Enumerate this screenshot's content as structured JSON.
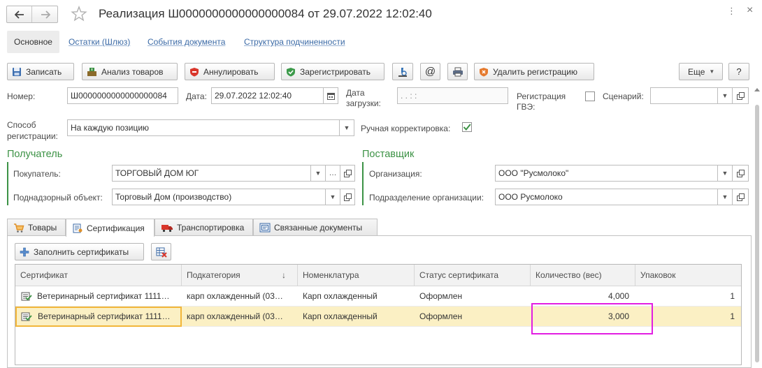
{
  "window": {
    "title": "Реализация Ш0000000000000000084 от 29.07.2022 12:02:40",
    "more_glyph": "⋮",
    "close_glyph": "×"
  },
  "page_tabs": [
    "Основное",
    "Остатки (Шлюз)",
    "События документа",
    "Структура подчиненности"
  ],
  "toolbar": {
    "save": "Записать",
    "analyze": "Анализ товаров",
    "cancel": "Аннулировать",
    "register": "Зарегистрировать",
    "at_symbol": "@",
    "delete_reg": "Удалить регистрацию",
    "more": "Еще",
    "help": "?"
  },
  "form": {
    "number_label": "Номер:",
    "number_value": "Ш0000000000000000084",
    "date_label": "Дата:",
    "date_value": "29.07.2022 12:02:40",
    "load_date_label_1": "Дата",
    "load_date_label_2": "загрузки:",
    "load_date_value": " .  .      :  :",
    "gve_label_1": "Регистрация",
    "gve_label_2": "ГВЭ:",
    "scenario_label": "Сценарий:",
    "scenario_value": "",
    "method_label_1": "Способ",
    "method_label_2": "регистрации:",
    "method_value": "На каждую позицию",
    "manual_label": "Ручная корректировка:"
  },
  "receiver": {
    "title": "Получатель",
    "buyer_label": "Покупатель:",
    "buyer_value": "ТОРГОВЫЙ ДОМ ЮГ",
    "object_label": "Поднадзорный объект:",
    "object_value": "Торговый Дом (производство)"
  },
  "supplier": {
    "title": "Поставщик",
    "org_label": "Организация:",
    "org_value": "ООО \"Русмолоко\"",
    "dept_label": "Подразделение организации:",
    "dept_value": "ООО Русмолоко"
  },
  "tabs": [
    "Товары",
    "Сертификация",
    "Транспортировка",
    "Связанные документы"
  ],
  "cert_panel": {
    "fill_button": "Заполнить сертификаты"
  },
  "table": {
    "columns": [
      "Сертификат",
      "Подкатегория",
      "Номенклатура",
      "Статус сертификата",
      "Количество (вес)",
      "Упаковок"
    ],
    "sort_glyph": "↓",
    "rows": [
      [
        "Ветеринарный сертификат 1111…",
        "карп охлажденный (03…",
        "Карп охлажденный",
        "Оформлен",
        "4,000",
        "1"
      ],
      [
        "Ветеринарный сертификат 1111…",
        "карп охлажденный (03…",
        "Карп охлажденный",
        "Оформлен",
        "3,000",
        "1"
      ]
    ]
  },
  "colors": {
    "group_title": "#3c9245",
    "link": "#3b6aa6",
    "selected_row": "#fbf0c4",
    "highlight_box": "#e21ee2",
    "focus_border": "#f2b63a"
  }
}
